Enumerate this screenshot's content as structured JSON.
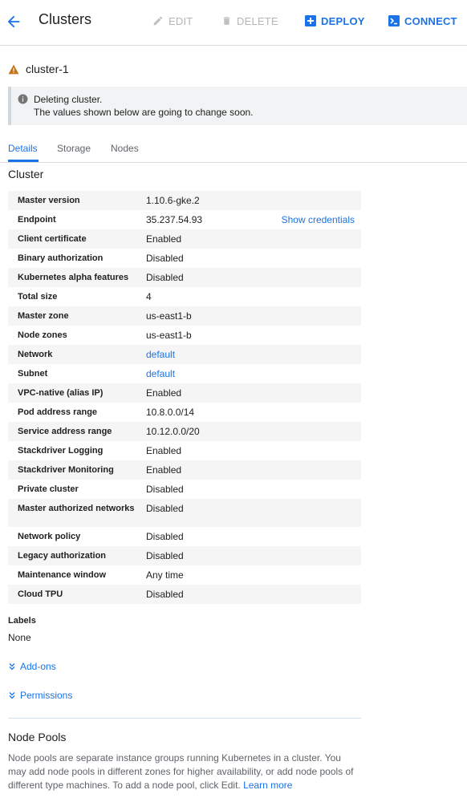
{
  "header": {
    "title": "Clusters",
    "edit_label": "EDIT",
    "delete_label": "DELETE",
    "deploy_label": "DEPLOY",
    "connect_label": "CONNECT"
  },
  "cluster": {
    "name": "cluster-1",
    "status_icon": "warning-icon"
  },
  "notice": {
    "line1": "Deleting cluster.",
    "line2": "The values shown below are going to change soon."
  },
  "tabs": [
    {
      "label": "Details",
      "active": true
    },
    {
      "label": "Storage",
      "active": false
    },
    {
      "label": "Nodes",
      "active": false
    }
  ],
  "details": {
    "section_title": "Cluster",
    "rows": [
      {
        "key": "Master version",
        "value": "1.10.6-gke.2"
      },
      {
        "key": "Endpoint",
        "value": "35.237.54.93",
        "action": "Show credentials"
      },
      {
        "key": "Client certificate",
        "value": "Enabled"
      },
      {
        "key": "Binary authorization",
        "value": "Disabled"
      },
      {
        "key": "Kubernetes alpha features",
        "value": "Disabled"
      },
      {
        "key": "Total size",
        "value": "4"
      },
      {
        "key": "Master zone",
        "value": "us-east1-b"
      },
      {
        "key": "Node zones",
        "value": "us-east1-b"
      },
      {
        "key": "Network",
        "value": "default",
        "link": true
      },
      {
        "key": "Subnet",
        "value": "default",
        "link": true
      },
      {
        "key": "VPC-native (alias IP)",
        "value": "Enabled"
      },
      {
        "key": "Pod address range",
        "value": "10.8.0.0/14"
      },
      {
        "key": "Service address range",
        "value": "10.12.0.0/20"
      },
      {
        "key": "Stackdriver Logging",
        "value": "Enabled"
      },
      {
        "key": "Stackdriver Monitoring",
        "value": "Enabled"
      },
      {
        "key": "Private cluster",
        "value": "Disabled"
      },
      {
        "key": "Master authorized networks",
        "value": "Disabled"
      },
      {
        "key": "Network policy",
        "value": "Disabled"
      },
      {
        "key": "Legacy authorization",
        "value": "Disabled"
      },
      {
        "key": "Maintenance window",
        "value": "Any time"
      },
      {
        "key": "Cloud TPU",
        "value": "Disabled"
      }
    ]
  },
  "labels": {
    "heading": "Labels",
    "value": "None"
  },
  "addons_label": "Add-ons",
  "permissions_label": "Permissions",
  "node_pools": {
    "title": "Node Pools",
    "description": "Node pools are separate instance groups running Kubernetes in a cluster. You may add node pools in different zones for higher availability, or add node pools of different type machines. To add a node pool, click Edit.",
    "learn_more": "Learn more"
  },
  "colors": {
    "accent": "#1a73e8",
    "warning": "#c5721a",
    "disabled": "#b5b5b5"
  }
}
